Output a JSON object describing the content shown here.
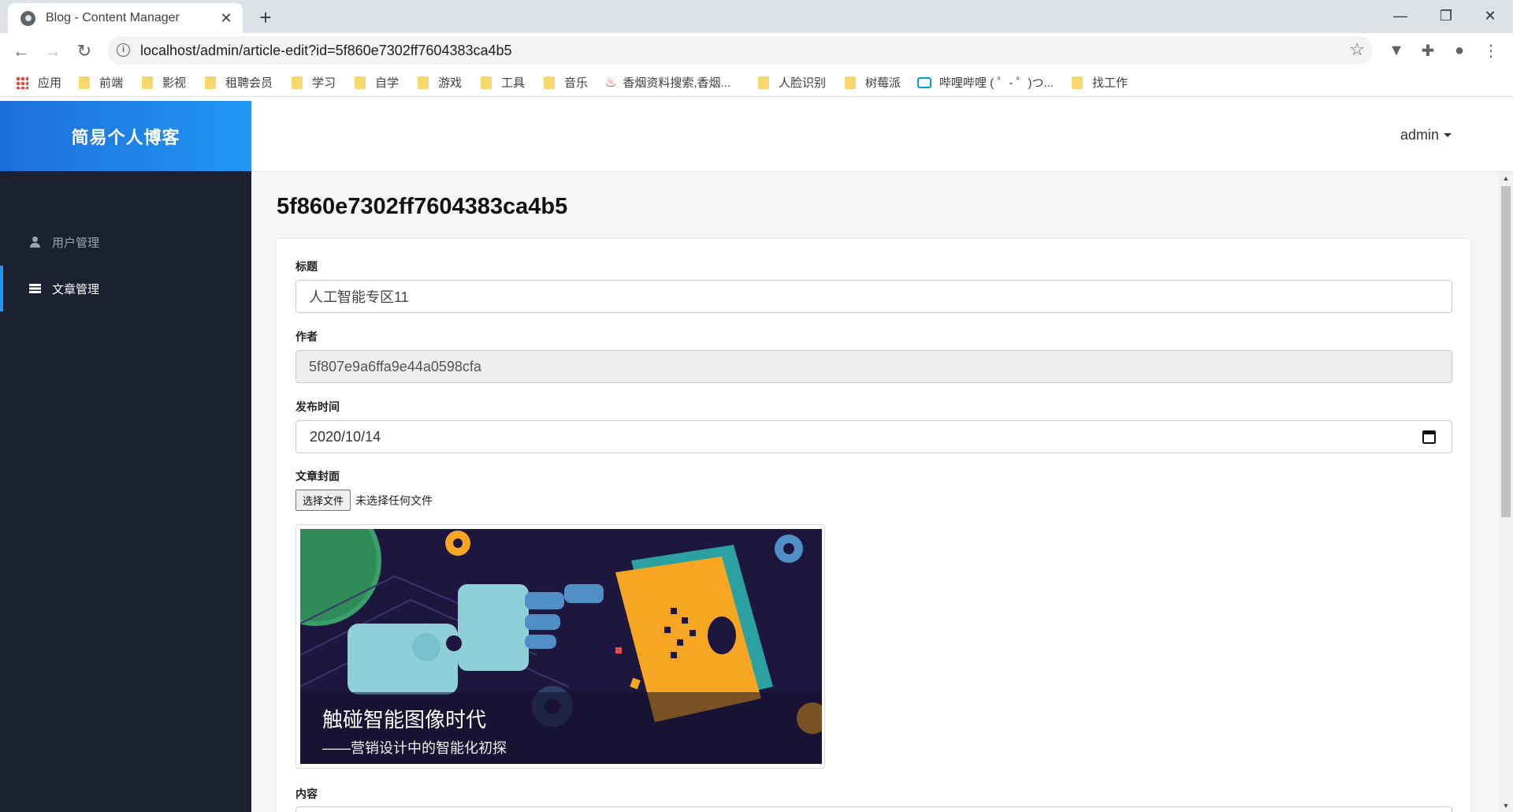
{
  "browser": {
    "tab_title": "Blog - Content Manager",
    "url": "localhost/admin/article-edit?id=5f860e7302ff7604383ca4b5",
    "bookmarks": [
      {
        "label": "应用",
        "icon": "apps-icon"
      },
      {
        "label": "前端",
        "icon": "folder-icon"
      },
      {
        "label": "影视",
        "icon": "folder-icon"
      },
      {
        "label": "租聘会员",
        "icon": "folder-icon"
      },
      {
        "label": "学习",
        "icon": "folder-icon"
      },
      {
        "label": "自学",
        "icon": "folder-icon"
      },
      {
        "label": "游戏",
        "icon": "folder-icon"
      },
      {
        "label": "工具",
        "icon": "folder-icon"
      },
      {
        "label": "音乐",
        "icon": "folder-icon"
      },
      {
        "label": "香烟资料搜索,香烟...",
        "icon": "flame-icon"
      },
      {
        "label": "人脸识别",
        "icon": "folder-icon"
      },
      {
        "label": "树莓派",
        "icon": "folder-icon"
      },
      {
        "label": "哔哩哔哩 ( ゜- ゜)つ...",
        "icon": "tv-icon"
      },
      {
        "label": "找工作",
        "icon": "folder-icon"
      }
    ]
  },
  "sidebar": {
    "brand": "简易个人博客",
    "items": [
      {
        "label": "用户管理",
        "icon": "user-icon",
        "active": false
      },
      {
        "label": "文章管理",
        "icon": "list-icon",
        "active": true
      }
    ]
  },
  "header": {
    "user": "admin"
  },
  "main": {
    "title": "5f860e7302ff7604383ca4b5",
    "form": {
      "title_label": "标题",
      "title_value": "人工智能专区11",
      "author_label": "作者",
      "author_value": "5f807e9a6ffa9e44a0598cfa",
      "date_label": "发布时间",
      "date_value": "2020/10/14",
      "cover_label": "文章封面",
      "file_button": "选择文件",
      "file_status": "未选择任何文件",
      "cover_title": "触碰智能图像时代",
      "cover_subtitle": "——营销设计中的智能化初探",
      "content_label": "内容"
    }
  },
  "colors": {
    "accent": "#2196f3",
    "sidebar_bg": "#1b2130",
    "content_bg": "#f6f6f6"
  }
}
